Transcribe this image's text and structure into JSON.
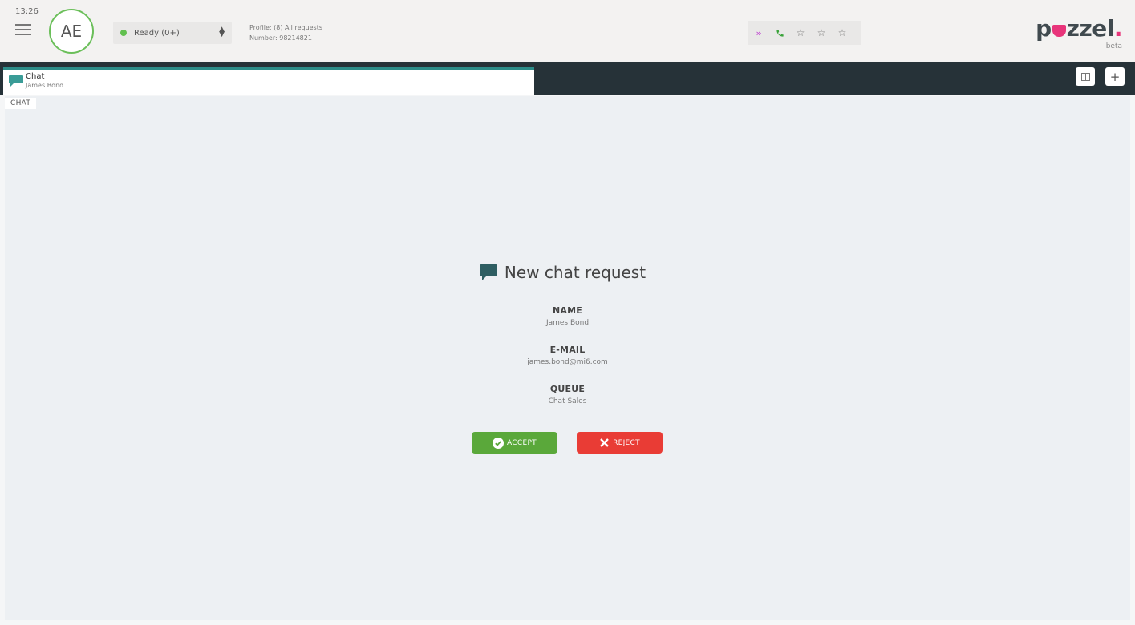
{
  "header": {
    "time": "13:26",
    "avatar_initials": "AE",
    "status": {
      "label": "Ready (0+)",
      "color": "#62c04f"
    },
    "profile": "Profile: (8) All requests",
    "number": "Number: 98214821",
    "toolbar_icons": [
      "forward-icon",
      "phone-icon",
      "star-icon",
      "star-icon",
      "star-icon"
    ],
    "logo": {
      "text_before": "p",
      "text_after": "zzel",
      "dot": ".",
      "beta": "beta"
    }
  },
  "tabs": [
    {
      "title": "Chat",
      "subtitle": "James Bond",
      "active": true
    }
  ],
  "tab_actions": [
    "columns-icon",
    "plus-icon"
  ],
  "panel": {
    "label": "CHAT"
  },
  "request": {
    "title": "New chat request",
    "fields": [
      {
        "label": "NAME",
        "value": "James Bond"
      },
      {
        "label": "E-MAIL",
        "value": "james.bond@mi6.com"
      },
      {
        "label": "QUEUE",
        "value": "Chat Sales"
      }
    ],
    "accept_label": "ACCEPT",
    "reject_label": "REJECT"
  },
  "colors": {
    "accent": "#2c8d89",
    "accept": "#5aa83a",
    "reject": "#e93c35",
    "tabbar": "#263238",
    "logo_dot": "#e8357b"
  }
}
